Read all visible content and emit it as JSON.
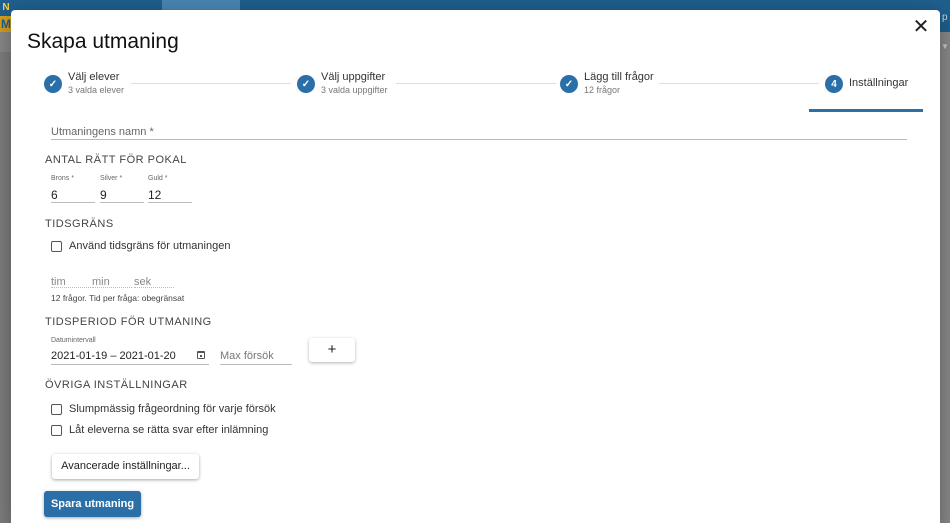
{
  "background": {
    "logo_top": "N O",
    "logo_bottom": "M",
    "edge_letter": "p"
  },
  "dialog": {
    "title": "Skapa utmaning",
    "close_glyph": "✕"
  },
  "stepper": {
    "steps": [
      {
        "label": "Välj elever",
        "sub": "3 valda elever",
        "state": "done"
      },
      {
        "label": "Välj uppgifter",
        "sub": "3 valda uppgifter",
        "state": "done"
      },
      {
        "label": "Lägg till frågor",
        "sub": "12 frågor",
        "state": "done"
      },
      {
        "label": "Inställningar",
        "sub": "",
        "state": "active",
        "number": "4"
      }
    ],
    "check_glyph": "✓"
  },
  "form": {
    "name_placeholder": "Utmaningens namn *",
    "trophy_section": "ANTAL RÄTT FÖR POKAL",
    "trophy": {
      "bronze_label": "Brons *",
      "bronze_value": "6",
      "silver_label": "Silver *",
      "silver_value": "9",
      "gold_label": "Guld *",
      "gold_value": "12"
    },
    "time_section": "TIDSGRÄNS",
    "use_time_limit_label": "Använd tidsgräns för utmaningen",
    "time_placeholders": {
      "hours": "tim",
      "minutes": "min",
      "seconds": "sek"
    },
    "time_info": "12 frågor. Tid per fråga: obegränsat",
    "period_section": "TIDSPERIOD FÖR UTMANING",
    "date_label": "Datumintervall",
    "date_value": "2021-01-19 – 2021-01-20",
    "max_attempts_placeholder": "Max försök",
    "add_glyph": "+",
    "other_section": "ÖVRIGA INSTÄLLNINGAR",
    "random_order_label": "Slumpmässig frågeordning för varje försök",
    "show_answers_label": "Låt eleverna se rätta svar efter inlämning",
    "advanced_button": "Avancerade inställningar...",
    "save_button": "Spara utmaning"
  },
  "colors": {
    "accent": "#2a6fa8",
    "topbar": "#1f5f8f"
  }
}
